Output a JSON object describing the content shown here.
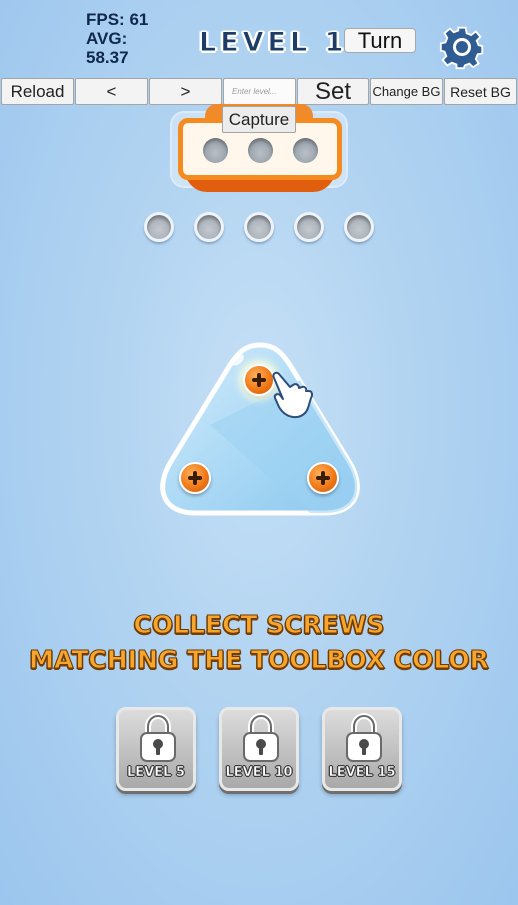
{
  "stats": {
    "fps": "FPS: 61",
    "avg_label": "AVG:",
    "avg_value": "58.37"
  },
  "header": {
    "level_title": "LEVEL 1",
    "turn_label": "Turn",
    "settings_icon": "gear-icon"
  },
  "toolbar": {
    "reload": "Reload",
    "prev": "<",
    "next": ">",
    "level_input_placeholder": "Enter level...",
    "set": "Set",
    "change_bg": "Change BG",
    "reset_bg": "Reset BG"
  },
  "toolbox": {
    "capture_label": "Capture",
    "color": "#f58a1e",
    "holes": 3
  },
  "collection_slots": 5,
  "board": {
    "shape": "rounded-triangle",
    "screws": [
      {
        "color": "orange",
        "active": true
      },
      {
        "color": "orange",
        "active": false
      },
      {
        "color": "orange",
        "active": false
      }
    ],
    "pointer_icon": "hand-pointer-icon"
  },
  "instructions": {
    "line1": "COLLECT SCREWS",
    "line2": "MATCHING THE TOOLBOX COLOR"
  },
  "locked_levels": [
    {
      "label": "LEVEL 5",
      "icon": "lock-icon"
    },
    {
      "label": "LEVEL 10",
      "icon": "lock-icon"
    },
    {
      "label": "LEVEL 15",
      "icon": "lock-icon"
    }
  ]
}
